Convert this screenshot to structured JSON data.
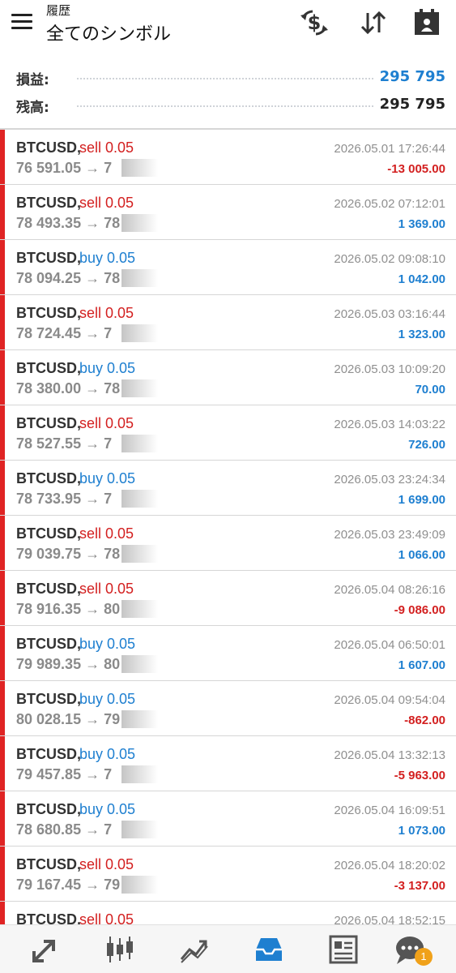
{
  "header": {
    "subtitle": "履歴",
    "title": "全てのシンボル"
  },
  "icons": {
    "menu": "hamburger-icon",
    "currency": "dollar-exchange-icon",
    "sort": "sort-arrows-icon",
    "period": "calendar-icon"
  },
  "summary": {
    "profit_label": "損益:",
    "profit_value": "295 795",
    "balance_label": "残高:",
    "balance_value": "295 795"
  },
  "colors": {
    "blue": "#1e7fd0",
    "red": "#d32020",
    "bar": "#e02424",
    "badge": "#f0a11a"
  },
  "trades": [
    {
      "symbol": "BTCUSD,",
      "side": "sell 0.05",
      "type": "sell",
      "price": "76 591.05 → 7",
      "time": "2026.05.01 17:26:44",
      "pl": "-13 005.00",
      "sign": "neg"
    },
    {
      "symbol": "BTCUSD,",
      "side": "sell 0.05",
      "type": "sell",
      "price": "78 493.35 → 78",
      "time": "2026.05.02 07:12:01",
      "pl": "1 369.00",
      "sign": "pos"
    },
    {
      "symbol": "BTCUSD,",
      "side": "buy 0.05",
      "type": "buy",
      "price": "78 094.25 → 78",
      "time": "2026.05.02 09:08:10",
      "pl": "1 042.00",
      "sign": "pos"
    },
    {
      "symbol": "BTCUSD,",
      "side": "sell 0.05",
      "type": "sell",
      "price": "78 724.45 → 7",
      "time": "2026.05.03 03:16:44",
      "pl": "1 323.00",
      "sign": "pos"
    },
    {
      "symbol": "BTCUSD,",
      "side": "buy 0.05",
      "type": "buy",
      "price": "78 380.00 → 78",
      "time": "2026.05.03 10:09:20",
      "pl": "70.00",
      "sign": "pos"
    },
    {
      "symbol": "BTCUSD,",
      "side": "sell 0.05",
      "type": "sell",
      "price": "78 527.55 → 7",
      "time": "2026.05.03 14:03:22",
      "pl": "726.00",
      "sign": "pos"
    },
    {
      "symbol": "BTCUSD,",
      "side": "buy 0.05",
      "type": "buy",
      "price": "78 733.95 → 7",
      "time": "2026.05.03 23:24:34",
      "pl": "1 699.00",
      "sign": "pos"
    },
    {
      "symbol": "BTCUSD,",
      "side": "sell 0.05",
      "type": "sell",
      "price": "79 039.75 → 78",
      "time": "2026.05.03 23:49:09",
      "pl": "1 066.00",
      "sign": "pos"
    },
    {
      "symbol": "BTCUSD,",
      "side": "sell 0.05",
      "type": "sell",
      "price": "78 916.35 → 80",
      "time": "2026.05.04 08:26:16",
      "pl": "-9 086.00",
      "sign": "neg"
    },
    {
      "symbol": "BTCUSD,",
      "side": "buy 0.05",
      "type": "buy",
      "price": "79 989.35 → 80",
      "time": "2026.05.04 06:50:01",
      "pl": "1 607.00",
      "sign": "pos"
    },
    {
      "symbol": "BTCUSD,",
      "side": "buy 0.05",
      "type": "buy",
      "price": "80 028.15 → 79",
      "time": "2026.05.04 09:54:04",
      "pl": "-862.00",
      "sign": "neg"
    },
    {
      "symbol": "BTCUSD,",
      "side": "buy 0.05",
      "type": "buy",
      "price": "79 457.85 → 7",
      "time": "2026.05.04 13:32:13",
      "pl": "-5 963.00",
      "sign": "neg"
    },
    {
      "symbol": "BTCUSD,",
      "side": "buy 0.05",
      "type": "buy",
      "price": "78 680.85 → 7",
      "time": "2026.05.04 16:09:51",
      "pl": "1 073.00",
      "sign": "pos"
    },
    {
      "symbol": "BTCUSD,",
      "side": "sell 0.05",
      "type": "sell",
      "price": "79 167.45 → 79",
      "time": "2026.05.04 18:20:02",
      "pl": "-3 137.00",
      "sign": "neg"
    },
    {
      "symbol": "BTCUSD,",
      "side": "sell 0.05",
      "type": "sell",
      "price": "",
      "time": "2026.05.04 18:52:15",
      "pl": "",
      "sign": "pos"
    }
  ],
  "nav": {
    "items": [
      "quotes-icon",
      "chart-icon",
      "trade-icon",
      "history-icon",
      "news-icon",
      "chat-icon"
    ],
    "chat_badge": "1"
  }
}
